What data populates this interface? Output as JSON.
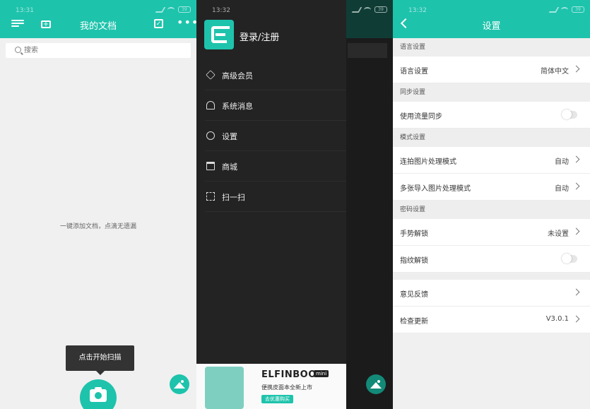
{
  "screen1": {
    "status_time": "13:31",
    "battery": "39",
    "title": "我的文档",
    "search_placeholder": "搜索",
    "empty_hint": "一键添加文档，点滴无遗漏",
    "tooltip": "点击开始扫描",
    "icons": [
      "menu-icon",
      "add-folder-icon",
      "multi-select-icon",
      "more-icon",
      "search-icon",
      "camera-icon",
      "gallery-icon"
    ]
  },
  "screen2": {
    "status_time": "13:32",
    "battery": "39",
    "login_label": "登录/注册",
    "menu": [
      {
        "label": "高级会员",
        "icon": "diamond-icon"
      },
      {
        "label": "系统消息",
        "icon": "bell-icon"
      },
      {
        "label": "设置",
        "icon": "settings-icon"
      },
      {
        "label": "商城",
        "icon": "shop-icon"
      },
      {
        "label": "扫一扫",
        "icon": "scan-icon"
      }
    ],
    "ad": {
      "brand": "ELFINBOOK",
      "badge": "mini",
      "subtitle": "便携皮面本全新上市",
      "button": "去优惠购买"
    }
  },
  "screen3": {
    "status_time": "13:32",
    "battery": "39",
    "title": "设置",
    "sections": [
      {
        "header": "语言设置",
        "rows": [
          {
            "label": "语言设置",
            "value": "简体中文",
            "control": "chevron"
          }
        ]
      },
      {
        "header": "同步设置",
        "rows": [
          {
            "label": "使用流量同步",
            "value": "",
            "control": "toggle",
            "on": false
          }
        ]
      },
      {
        "header": "模式设置",
        "rows": [
          {
            "label": "连拍图片处理模式",
            "value": "自动",
            "control": "chevron"
          },
          {
            "label": "多张导入图片处理模式",
            "value": "自动",
            "control": "chevron"
          }
        ]
      },
      {
        "header": "密码设置",
        "rows": [
          {
            "label": "手势解锁",
            "value": "未设置",
            "control": "chevron"
          },
          {
            "label": "指纹解锁",
            "value": "",
            "control": "toggle",
            "on": false
          }
        ]
      },
      {
        "header": "",
        "rows": [
          {
            "label": "意见反馈",
            "value": "",
            "control": "chevron"
          },
          {
            "label": "检查更新",
            "value": "V3.0.1",
            "control": "chevron"
          }
        ]
      }
    ]
  },
  "colors": {
    "accent": "#1ec3ac",
    "drawer": "#232323",
    "background": "#f0f0f0"
  }
}
